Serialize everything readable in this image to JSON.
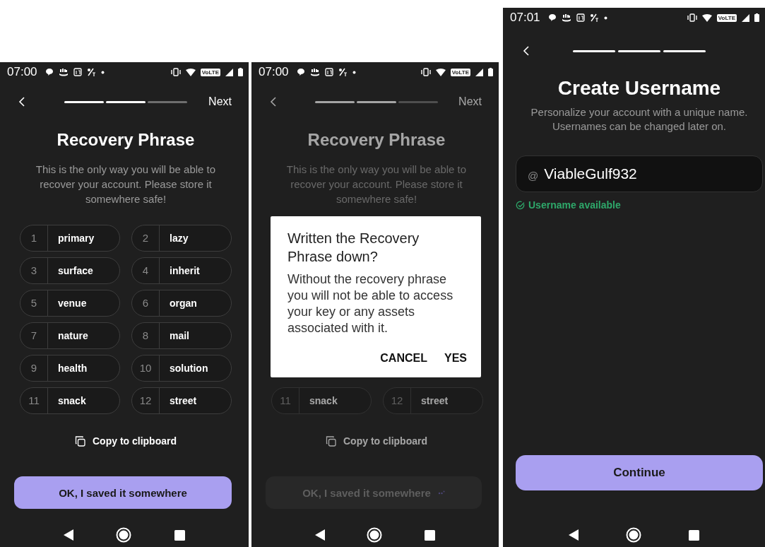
{
  "screens": [
    {
      "kind": "phrase",
      "dimmed": false,
      "status_bar": {
        "time": "07:00",
        "network_badge": "VoLTE"
      },
      "steps": [
        {
          "done": true
        },
        {
          "done": true
        },
        {
          "done": false
        }
      ],
      "next": "Next",
      "title": "Recovery Phrase",
      "description": "This is the only way you will be able to recover your account. Please store it somewhere safe!",
      "words": [
        {
          "index": "1",
          "word": "primary"
        },
        {
          "index": "2",
          "word": "lazy"
        },
        {
          "index": "3",
          "word": "surface"
        },
        {
          "index": "4",
          "word": "inherit"
        },
        {
          "index": "5",
          "word": "venue"
        },
        {
          "index": "6",
          "word": "organ"
        },
        {
          "index": "7",
          "word": "nature"
        },
        {
          "index": "8",
          "word": "mail"
        },
        {
          "index": "9",
          "word": "health"
        },
        {
          "index": "10",
          "word": "solution"
        },
        {
          "index": "11",
          "word": "snack"
        },
        {
          "index": "12",
          "word": "street"
        }
      ],
      "copy": "Copy to clipboard",
      "button": {
        "label": "OK, I saved it somewhere"
      }
    },
    {
      "kind": "phrase",
      "dimmed": true,
      "status_bar": {
        "time": "07:00",
        "network_badge": "VoLTE"
      },
      "steps": [
        {
          "done": true
        },
        {
          "done": true
        },
        {
          "done": false
        }
      ],
      "next": "Next",
      "title": "Recovery Phrase",
      "description": "This is the only way you will be able to recover your account. Please store it somewhere safe!",
      "words": [
        {
          "index": "11",
          "word": "snack"
        },
        {
          "index": "12",
          "word": "street"
        }
      ],
      "copy": "Copy to clipboard",
      "button": {
        "label": "OK, I saved it somewhere",
        "loading": true
      },
      "dialog": {
        "title": "Written the Recovery Phrase down?",
        "message": "Without the recovery phrase you will not be able to access your key or any assets associated with it.",
        "actions": [
          "CANCEL",
          "YES"
        ]
      }
    },
    {
      "kind": "username",
      "status_bar": {
        "time": "07:01",
        "network_badge": "VoLTE"
      },
      "steps": [
        {
          "done": true
        },
        {
          "done": true
        },
        {
          "done": true
        }
      ],
      "title": "Create Username",
      "description": "Personalize your account with a unique name. Usernames can be changed later on.",
      "field": {
        "prefix": "@",
        "value": "ViableGulf932"
      },
      "availability": "Username available",
      "button": {
        "label": "Continue"
      }
    }
  ]
}
